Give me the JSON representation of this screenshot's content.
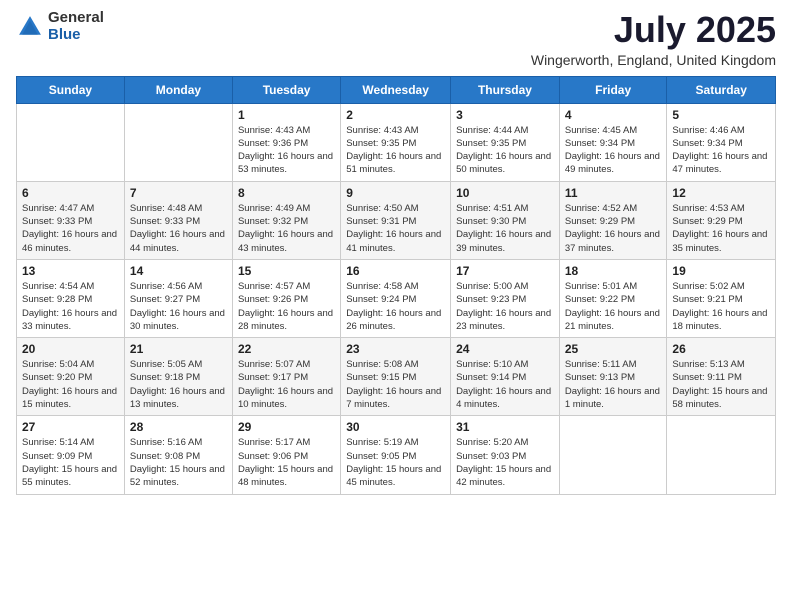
{
  "logo": {
    "general": "General",
    "blue": "Blue"
  },
  "title": "July 2025",
  "location": "Wingerworth, England, United Kingdom",
  "days_header": [
    "Sunday",
    "Monday",
    "Tuesday",
    "Wednesday",
    "Thursday",
    "Friday",
    "Saturday"
  ],
  "weeks": [
    [
      {
        "day": "",
        "sunrise": "",
        "sunset": "",
        "daylight": ""
      },
      {
        "day": "",
        "sunrise": "",
        "sunset": "",
        "daylight": ""
      },
      {
        "day": "1",
        "sunrise": "Sunrise: 4:43 AM",
        "sunset": "Sunset: 9:36 PM",
        "daylight": "Daylight: 16 hours and 53 minutes."
      },
      {
        "day": "2",
        "sunrise": "Sunrise: 4:43 AM",
        "sunset": "Sunset: 9:35 PM",
        "daylight": "Daylight: 16 hours and 51 minutes."
      },
      {
        "day": "3",
        "sunrise": "Sunrise: 4:44 AM",
        "sunset": "Sunset: 9:35 PM",
        "daylight": "Daylight: 16 hours and 50 minutes."
      },
      {
        "day": "4",
        "sunrise": "Sunrise: 4:45 AM",
        "sunset": "Sunset: 9:34 PM",
        "daylight": "Daylight: 16 hours and 49 minutes."
      },
      {
        "day": "5",
        "sunrise": "Sunrise: 4:46 AM",
        "sunset": "Sunset: 9:34 PM",
        "daylight": "Daylight: 16 hours and 47 minutes."
      }
    ],
    [
      {
        "day": "6",
        "sunrise": "Sunrise: 4:47 AM",
        "sunset": "Sunset: 9:33 PM",
        "daylight": "Daylight: 16 hours and 46 minutes."
      },
      {
        "day": "7",
        "sunrise": "Sunrise: 4:48 AM",
        "sunset": "Sunset: 9:33 PM",
        "daylight": "Daylight: 16 hours and 44 minutes."
      },
      {
        "day": "8",
        "sunrise": "Sunrise: 4:49 AM",
        "sunset": "Sunset: 9:32 PM",
        "daylight": "Daylight: 16 hours and 43 minutes."
      },
      {
        "day": "9",
        "sunrise": "Sunrise: 4:50 AM",
        "sunset": "Sunset: 9:31 PM",
        "daylight": "Daylight: 16 hours and 41 minutes."
      },
      {
        "day": "10",
        "sunrise": "Sunrise: 4:51 AM",
        "sunset": "Sunset: 9:30 PM",
        "daylight": "Daylight: 16 hours and 39 minutes."
      },
      {
        "day": "11",
        "sunrise": "Sunrise: 4:52 AM",
        "sunset": "Sunset: 9:29 PM",
        "daylight": "Daylight: 16 hours and 37 minutes."
      },
      {
        "day": "12",
        "sunrise": "Sunrise: 4:53 AM",
        "sunset": "Sunset: 9:29 PM",
        "daylight": "Daylight: 16 hours and 35 minutes."
      }
    ],
    [
      {
        "day": "13",
        "sunrise": "Sunrise: 4:54 AM",
        "sunset": "Sunset: 9:28 PM",
        "daylight": "Daylight: 16 hours and 33 minutes."
      },
      {
        "day": "14",
        "sunrise": "Sunrise: 4:56 AM",
        "sunset": "Sunset: 9:27 PM",
        "daylight": "Daylight: 16 hours and 30 minutes."
      },
      {
        "day": "15",
        "sunrise": "Sunrise: 4:57 AM",
        "sunset": "Sunset: 9:26 PM",
        "daylight": "Daylight: 16 hours and 28 minutes."
      },
      {
        "day": "16",
        "sunrise": "Sunrise: 4:58 AM",
        "sunset": "Sunset: 9:24 PM",
        "daylight": "Daylight: 16 hours and 26 minutes."
      },
      {
        "day": "17",
        "sunrise": "Sunrise: 5:00 AM",
        "sunset": "Sunset: 9:23 PM",
        "daylight": "Daylight: 16 hours and 23 minutes."
      },
      {
        "day": "18",
        "sunrise": "Sunrise: 5:01 AM",
        "sunset": "Sunset: 9:22 PM",
        "daylight": "Daylight: 16 hours and 21 minutes."
      },
      {
        "day": "19",
        "sunrise": "Sunrise: 5:02 AM",
        "sunset": "Sunset: 9:21 PM",
        "daylight": "Daylight: 16 hours and 18 minutes."
      }
    ],
    [
      {
        "day": "20",
        "sunrise": "Sunrise: 5:04 AM",
        "sunset": "Sunset: 9:20 PM",
        "daylight": "Daylight: 16 hours and 15 minutes."
      },
      {
        "day": "21",
        "sunrise": "Sunrise: 5:05 AM",
        "sunset": "Sunset: 9:18 PM",
        "daylight": "Daylight: 16 hours and 13 minutes."
      },
      {
        "day": "22",
        "sunrise": "Sunrise: 5:07 AM",
        "sunset": "Sunset: 9:17 PM",
        "daylight": "Daylight: 16 hours and 10 minutes."
      },
      {
        "day": "23",
        "sunrise": "Sunrise: 5:08 AM",
        "sunset": "Sunset: 9:15 PM",
        "daylight": "Daylight: 16 hours and 7 minutes."
      },
      {
        "day": "24",
        "sunrise": "Sunrise: 5:10 AM",
        "sunset": "Sunset: 9:14 PM",
        "daylight": "Daylight: 16 hours and 4 minutes."
      },
      {
        "day": "25",
        "sunrise": "Sunrise: 5:11 AM",
        "sunset": "Sunset: 9:13 PM",
        "daylight": "Daylight: 16 hours and 1 minute."
      },
      {
        "day": "26",
        "sunrise": "Sunrise: 5:13 AM",
        "sunset": "Sunset: 9:11 PM",
        "daylight": "Daylight: 15 hours and 58 minutes."
      }
    ],
    [
      {
        "day": "27",
        "sunrise": "Sunrise: 5:14 AM",
        "sunset": "Sunset: 9:09 PM",
        "daylight": "Daylight: 15 hours and 55 minutes."
      },
      {
        "day": "28",
        "sunrise": "Sunrise: 5:16 AM",
        "sunset": "Sunset: 9:08 PM",
        "daylight": "Daylight: 15 hours and 52 minutes."
      },
      {
        "day": "29",
        "sunrise": "Sunrise: 5:17 AM",
        "sunset": "Sunset: 9:06 PM",
        "daylight": "Daylight: 15 hours and 48 minutes."
      },
      {
        "day": "30",
        "sunrise": "Sunrise: 5:19 AM",
        "sunset": "Sunset: 9:05 PM",
        "daylight": "Daylight: 15 hours and 45 minutes."
      },
      {
        "day": "31",
        "sunrise": "Sunrise: 5:20 AM",
        "sunset": "Sunset: 9:03 PM",
        "daylight": "Daylight: 15 hours and 42 minutes."
      },
      {
        "day": "",
        "sunrise": "",
        "sunset": "",
        "daylight": ""
      },
      {
        "day": "",
        "sunrise": "",
        "sunset": "",
        "daylight": ""
      }
    ]
  ]
}
